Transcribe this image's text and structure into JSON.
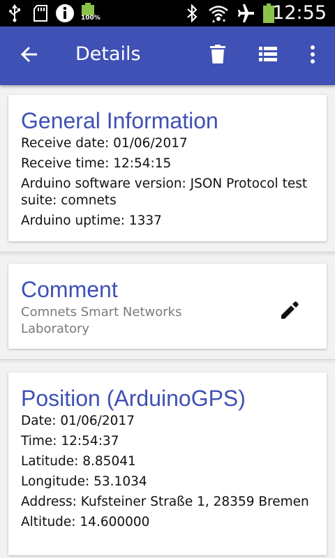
{
  "status_bar": {
    "icons": [
      "usb-icon",
      "sd-card-icon",
      "info-icon",
      "battery-small-icon",
      "bluetooth-icon",
      "wifi-icon",
      "airplane-icon",
      "battery-icon"
    ],
    "battery_small_label": "100%",
    "time": "12:55"
  },
  "app_bar": {
    "title": "Details",
    "actions": [
      "back-arrow-icon",
      "delete-icon",
      "list-icon",
      "more-vert-icon"
    ],
    "color": "#3f51b5"
  },
  "general": {
    "title": "General Information",
    "lines": [
      "Receive date: 01/06/2017",
      "Receive time: 12:54:15",
      "Arduino software version: JSON Protocol test suite: comnets",
      "Arduino uptime: 1337"
    ]
  },
  "comment": {
    "title": "Comment",
    "text": "Comnets Smart Networks Laboratory",
    "edit_icon": "edit-pencil-icon"
  },
  "position": {
    "title": "Position (ArduinoGPS)",
    "lines": [
      "Date: 01/06/2017",
      "Time: 12:54:37",
      "Latitude: 8.85041",
      "Longitude: 53.1034",
      "Address: Kufsteiner Straße 1, 28359 Bremen",
      "Altitude: 14.600000"
    ]
  },
  "colors": {
    "accent": "#3f51b5",
    "battery": "#8bc34a"
  }
}
